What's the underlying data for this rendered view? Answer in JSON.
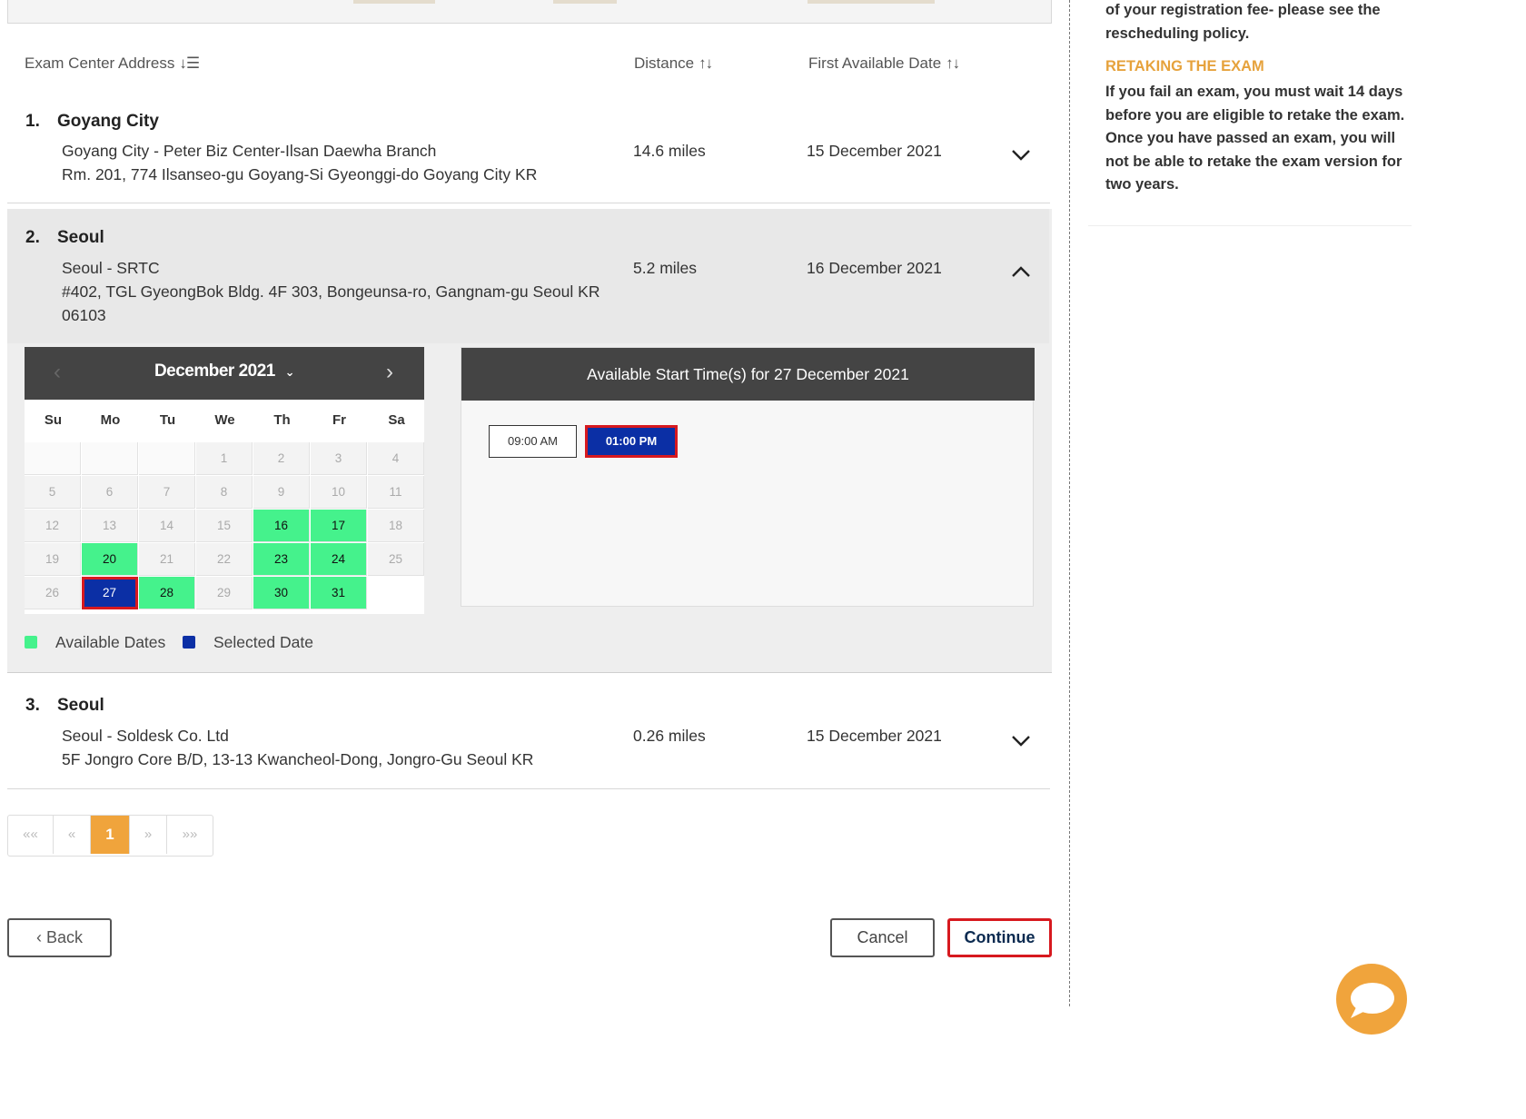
{
  "table": {
    "headers": {
      "address": "Exam Center Address",
      "distance": "Distance",
      "first_date": "First Available Date"
    },
    "rows": [
      {
        "num": "1.",
        "city": "Goyang City",
        "name": "Goyang City - Peter Biz Center-Ilsan Daewha Branch",
        "address_lines": [
          "Rm. 201, 774 Ilsanseo-gu Goyang-Si Gyeonggi-do Goyang City KR"
        ],
        "distance": "14.6 miles",
        "first_date": "15 December 2021",
        "expanded": false
      },
      {
        "num": "2.",
        "city": "Seoul",
        "name": "Seoul - SRTC",
        "address_lines": [
          "#402, TGL GyeongBok Bldg. 4F 303, Bongeunsa-ro, Gangnam-gu Seoul KR",
          "06103"
        ],
        "distance": "5.2 miles",
        "first_date": "16 December 2021",
        "expanded": true
      },
      {
        "num": "3.",
        "city": "Seoul",
        "name": "Seoul - Soldesk Co. Ltd",
        "address_lines": [
          "5F Jongro Core B/D, 13-13 Kwancheol-Dong, Jongro-Gu Seoul KR"
        ],
        "distance": "0.26 miles",
        "first_date": "15 December 2021",
        "expanded": false
      }
    ]
  },
  "calendar": {
    "month_label": "December 2021",
    "weekdays": [
      "Su",
      "Mo",
      "Tu",
      "We",
      "Th",
      "Fr",
      "Sa"
    ],
    "first_weekday_index": 3,
    "days_in_month": 31,
    "available_days": [
      16,
      17,
      20,
      23,
      24,
      28,
      30,
      31
    ],
    "selected_day": 27,
    "legend": {
      "available": "Available Dates",
      "selected": "Selected Date"
    },
    "colors": {
      "available": "#45f28c",
      "selected": "#0b2fa5",
      "highlight": "#d7191f"
    }
  },
  "times": {
    "header": "Available Start Time(s) for 27 December 2021",
    "slots": [
      {
        "label": "09:00 AM",
        "selected": false
      },
      {
        "label": "01:00 PM",
        "selected": true
      }
    ]
  },
  "pagination": {
    "first": "««",
    "prev": "«",
    "current": "1",
    "next": "»",
    "last": "»»"
  },
  "actions": {
    "back": "‹ Back",
    "cancel": "Cancel",
    "continue": "Continue"
  },
  "sidebar": {
    "fee_text": "of your registration fee- please see the rescheduling policy.",
    "retake_heading": "RETAKING THE EXAM",
    "retake_text": "If you fail an exam, you must wait 14 days before you are eligible to retake the exam. Once you have passed an exam, you will not be able to retake the exam version for two years."
  },
  "chat": {
    "icon": "chat-bubble-icon",
    "color": "#f0a43c"
  }
}
